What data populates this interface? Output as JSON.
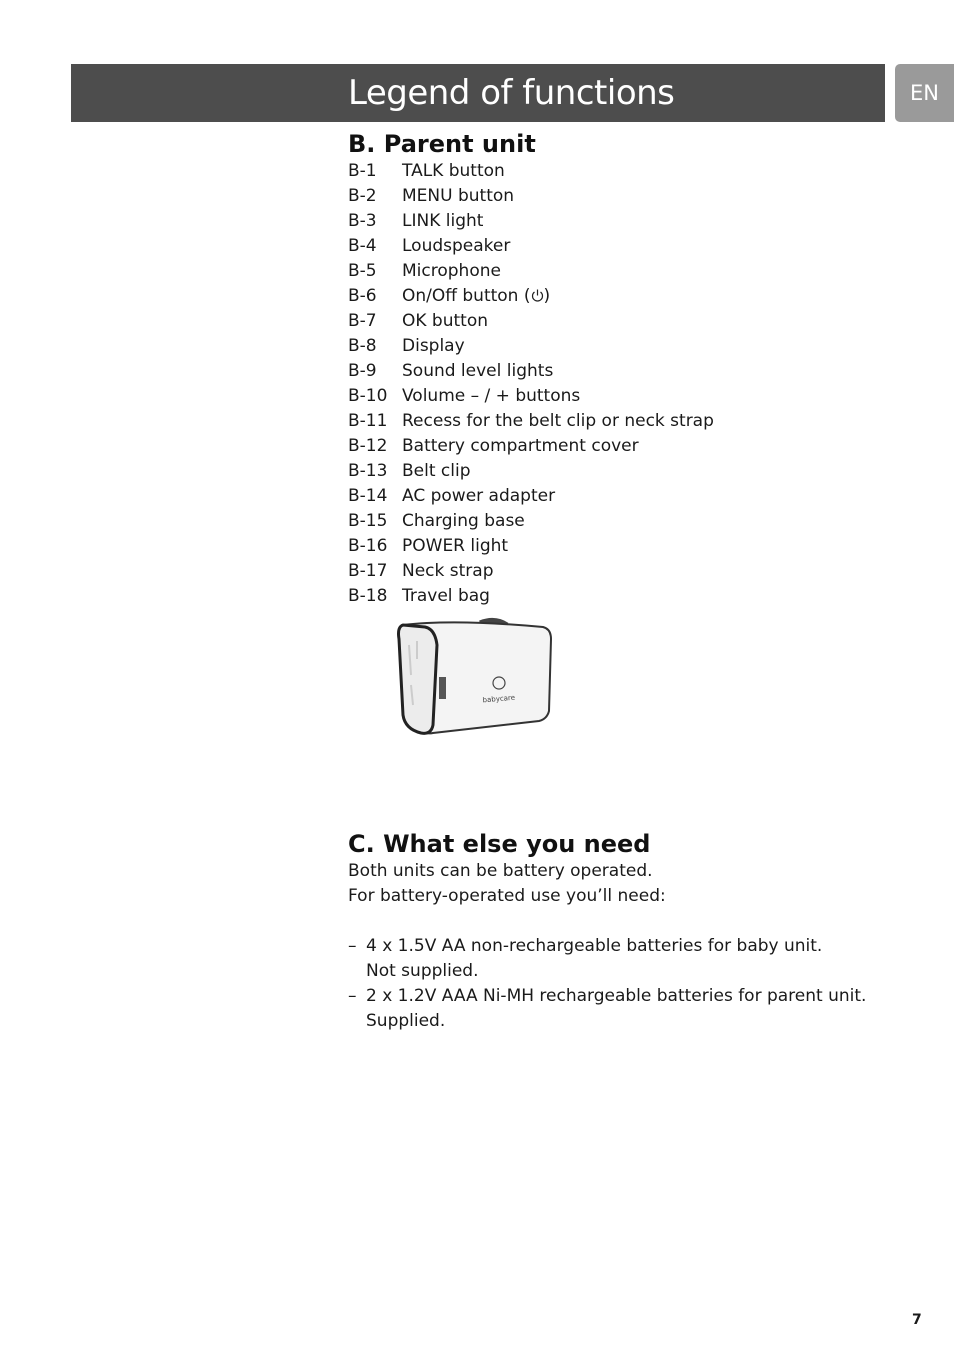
{
  "header": {
    "title": "Legend of functions",
    "language_tab": "EN"
  },
  "section_b": {
    "heading": "B. Parent unit",
    "items": [
      {
        "code": "B-1",
        "label": "TALK button"
      },
      {
        "code": "B-2",
        "label": "MENU button"
      },
      {
        "code": "B-3",
        "label": "LINK light"
      },
      {
        "code": "B-4",
        "label": "Loudspeaker"
      },
      {
        "code": "B-5",
        "label": "Microphone"
      },
      {
        "code": "B-6",
        "label": "On/Off button (",
        "suffix": ")",
        "icon": "power-icon"
      },
      {
        "code": "B-7",
        "label": "OK button"
      },
      {
        "code": "B-8",
        "label": "Display"
      },
      {
        "code": "B-9",
        "label": "Sound level lights"
      },
      {
        "code": "B-10",
        "label": "Volume – / + buttons"
      },
      {
        "code": "B-11",
        "label": "Recess for the belt clip or neck strap"
      },
      {
        "code": "B-12",
        "label": "Battery compartment cover"
      },
      {
        "code": "B-13",
        "label": "Belt clip"
      },
      {
        "code": "B-14",
        "label": "AC power adapter"
      },
      {
        "code": "B-15",
        "label": "Charging base"
      },
      {
        "code": "B-16",
        "label": "POWER light"
      },
      {
        "code": "B-17",
        "label": "Neck strap"
      },
      {
        "code": "B-18",
        "label": "Travel bag"
      }
    ],
    "image": {
      "logo_text": "babycare"
    }
  },
  "section_c": {
    "heading": "C. What else you need",
    "intro": [
      "Both units can be battery operated.",
      "For battery-operated use you’ll need:"
    ],
    "bullets": [
      {
        "dash": "–",
        "lines": [
          "4 x 1.5V  AA non-rechargeable batteries for baby unit.",
          "Not supplied."
        ]
      },
      {
        "dash": "–",
        "lines": [
          "2 x 1.2V AAA Ni-MH rechargeable batteries for parent unit.",
          "Supplied."
        ]
      }
    ]
  },
  "page_number": "7"
}
